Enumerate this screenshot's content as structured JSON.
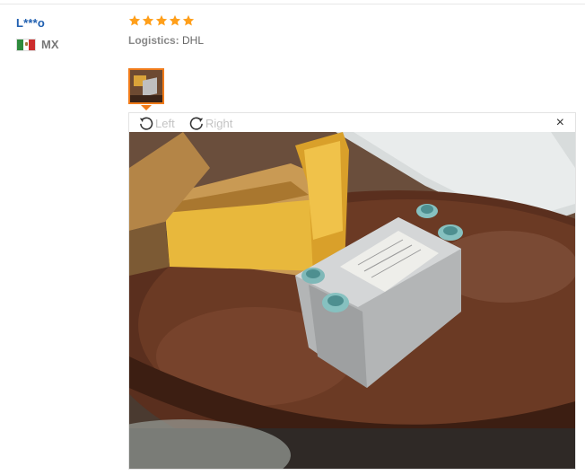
{
  "reviewer": {
    "name": "L***o",
    "country": "MX"
  },
  "review": {
    "rating": 5,
    "logistics_label": "Logistics:",
    "logistics_value": "DHL"
  },
  "image_viewer": {
    "rotate_left_label": "Left",
    "rotate_right_label": "Right",
    "close_glyph": "×"
  },
  "colors": {
    "username": "#1f5fb0",
    "star": "#ff9f1a",
    "thumb_border": "#f07b1a"
  },
  "icons": [
    "mexico-flag-icon",
    "star-icon",
    "rotate-left-icon",
    "rotate-right-icon",
    "close-icon"
  ]
}
